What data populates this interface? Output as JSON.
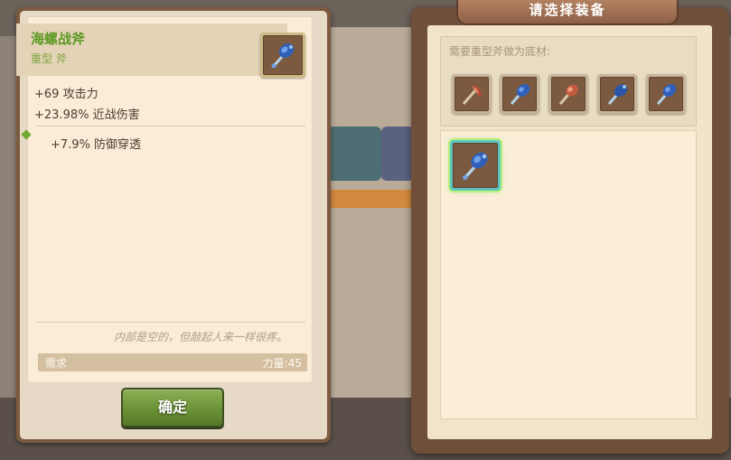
{
  "detail": {
    "name": "海螺战斧",
    "type": "重型 斧",
    "stats": [
      "+69 攻击力",
      "+23.98% 近战伤害"
    ],
    "bonus": "+7.9% 防御穿透",
    "flavor": "内部是空的，但敲起人来一样很疼。",
    "requirement_label": "需求",
    "requirement_value": "力量:45",
    "item_icon": "blue-axe-icon"
  },
  "confirm_label": "确定",
  "selection": {
    "title": "请选择装备",
    "material_label": "需要重型斧做为底材:",
    "material_icons": [
      "red-axe-icon",
      "blue-axe-icon",
      "red-axe-icon",
      "blue-axe-icon",
      "blue-axe-icon"
    ],
    "selected_icon": "blue-axe-icon"
  },
  "colors": {
    "name_green": "#5e9924",
    "button_green": "#6b9236",
    "panel_brown": "#6f4f3a",
    "selection_glow": "#5ec6c0"
  }
}
